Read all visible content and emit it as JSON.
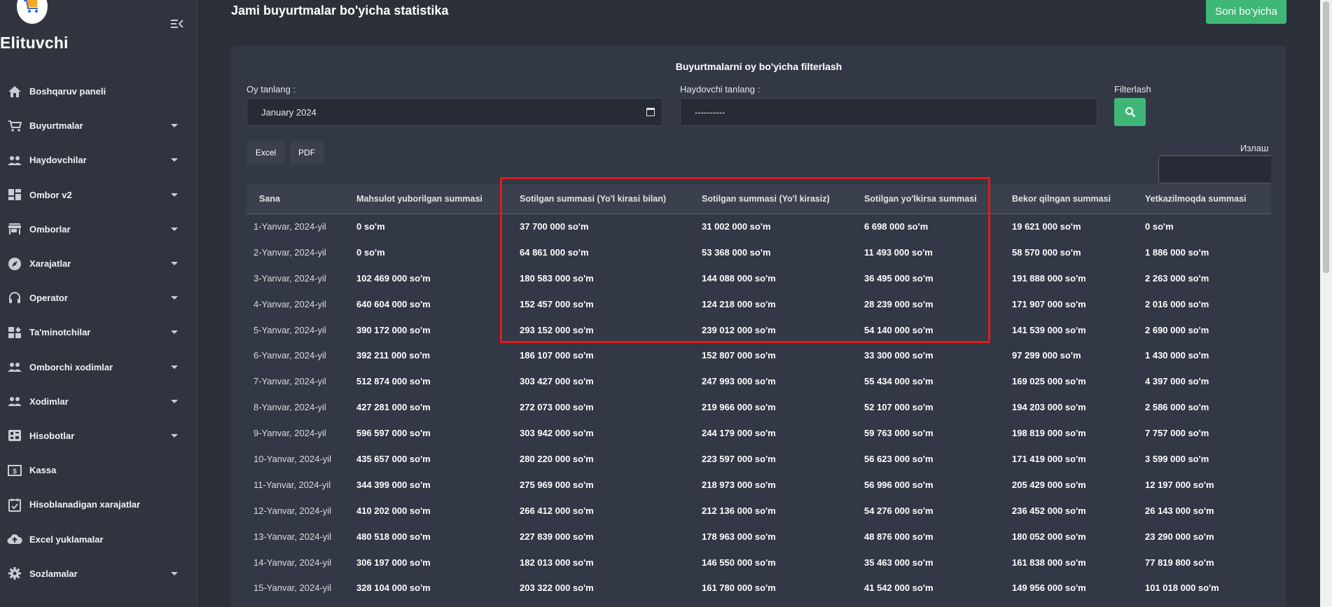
{
  "brand": "Elituvchi",
  "sidebar": {
    "items": [
      {
        "label": "Boshqaruv paneli",
        "icon": "home-icon",
        "has_submenu": false
      },
      {
        "label": "Buyurtmalar",
        "icon": "cart-icon",
        "has_submenu": true
      },
      {
        "label": "Haydovchilar",
        "icon": "people-icon",
        "has_submenu": true
      },
      {
        "label": "Ombor v2",
        "icon": "dashboard-icon",
        "has_submenu": true
      },
      {
        "label": "Omborlar",
        "icon": "store-icon",
        "has_submenu": true
      },
      {
        "label": "Xarajatlar",
        "icon": "explore-icon",
        "has_submenu": true
      },
      {
        "label": "Operator",
        "icon": "headset-icon",
        "has_submenu": true
      },
      {
        "label": "Ta'minotchilar",
        "icon": "suppliers-icon",
        "has_submenu": true
      },
      {
        "label": "Omborchi xodimlar",
        "icon": "people-icon",
        "has_submenu": true
      },
      {
        "label": "Xodimlar",
        "icon": "people-icon",
        "has_submenu": true
      },
      {
        "label": "Hisobotlar",
        "icon": "grid-icon",
        "has_submenu": true
      },
      {
        "label": "Kassa",
        "icon": "money-icon",
        "has_submenu": false
      },
      {
        "label": "Hisoblanadigan xarajatlar",
        "icon": "calendar-check-icon",
        "has_submenu": false
      },
      {
        "label": "Excel yuklamalar",
        "icon": "cloud-upload-icon",
        "has_submenu": false
      },
      {
        "label": "Sozlamalar",
        "icon": "gear-icon",
        "has_submenu": true
      }
    ]
  },
  "header": {
    "title": "Jami buyurtmalar bo'yicha statistika",
    "soni_button": "Soni bo'yicha"
  },
  "filter": {
    "title": "Buyurtmalarni oy bo'yicha filterlash",
    "month_label": "Oy tanlang :",
    "month_value": "January 2024",
    "driver_label": "Haydovchi tanlang :",
    "driver_value": "----------",
    "filter_label": "Filterlash"
  },
  "export": {
    "excel": "Excel",
    "pdf": "PDF"
  },
  "search": {
    "label": "Излаш"
  },
  "colors": {
    "accent_green": "#3fb877",
    "highlight_red": "#e01b1b"
  },
  "table": {
    "headers": [
      "Sana",
      "Mahsulot yuborilgan summasi",
      "Sotilgan summasi (Yo'l kirasi bilan)",
      "Sotilgan summasi (Yo'l kirasiz)",
      "Sotilgan yo'lkirsa summasi",
      "Bekor qilngan summasi",
      "Yetkazilmoqda summasi"
    ],
    "rows": [
      [
        "1-Yanvar, 2024-yil",
        "0 so'm",
        "37 700 000 so'm",
        "31 002 000 so'm",
        "6 698 000 so'm",
        "19 621 000 so'm",
        "0 so'm"
      ],
      [
        "2-Yanvar, 2024-yil",
        "0 so'm",
        "64 861 000 so'm",
        "53 368 000 so'm",
        "11 493 000 so'm",
        "58 570 000 so'm",
        "1 886 000 so'm"
      ],
      [
        "3-Yanvar, 2024-yil",
        "102 469 000 so'm",
        "180 583 000 so'm",
        "144 088 000 so'm",
        "36 495 000 so'm",
        "191 888 000 so'm",
        "2 263 000 so'm"
      ],
      [
        "4-Yanvar, 2024-yil",
        "640 604 000 so'm",
        "152 457 000 so'm",
        "124 218 000 so'm",
        "28 239 000 so'm",
        "171 907 000 so'm",
        "2 016 000 so'm"
      ],
      [
        "5-Yanvar, 2024-yil",
        "390 172 000 so'm",
        "293 152 000 so'm",
        "239 012 000 so'm",
        "54 140 000 so'm",
        "141 539 000 so'm",
        "2 690 000 so'm"
      ],
      [
        "6-Yanvar, 2024-yil",
        "392 211 000 so'm",
        "186 107 000 so'm",
        "152 807 000 so'm",
        "33 300 000 so'm",
        "97 299 000 so'm",
        "1 430 000 so'm"
      ],
      [
        "7-Yanvar, 2024-yil",
        "512 874 000 so'm",
        "303 427 000 so'm",
        "247 993 000 so'm",
        "55 434 000 so'm",
        "169 025 000 so'm",
        "4 397 000 so'm"
      ],
      [
        "8-Yanvar, 2024-yil",
        "427 281 000 so'm",
        "272 073 000 so'm",
        "219 966 000 so'm",
        "52 107 000 so'm",
        "194 203 000 so'm",
        "2 586 000 so'm"
      ],
      [
        "9-Yanvar, 2024-yil",
        "596 597 000 so'm",
        "303 942 000 so'm",
        "244 179 000 so'm",
        "59 763 000 so'm",
        "198 819 000 so'm",
        "7 757 000 so'm"
      ],
      [
        "10-Yanvar, 2024-yil",
        "435 657 000 so'm",
        "280 220 000 so'm",
        "223 597 000 so'm",
        "56 623 000 so'm",
        "171 419 000 so'm",
        "3 599 000 so'm"
      ],
      [
        "11-Yanvar, 2024-yil",
        "344 399 000 so'm",
        "275 969 000 so'm",
        "218 973 000 so'm",
        "56 996 000 so'm",
        "205 429 000 so'm",
        "12 197 000 so'm"
      ],
      [
        "12-Yanvar, 2024-yil",
        "410 202 000 so'm",
        "266 412 000 so'm",
        "212 136 000 so'm",
        "54 276 000 so'm",
        "236 452 000 so'm",
        "26 143 000 so'm"
      ],
      [
        "13-Yanvar, 2024-yil",
        "480 518 000 so'm",
        "227 839 000 so'm",
        "178 963 000 so'm",
        "48 876 000 so'm",
        "180 052 000 so'm",
        "23 290 000 so'm"
      ],
      [
        "14-Yanvar, 2024-yil",
        "306 197 000 so'm",
        "182 013 000 so'm",
        "146 550 000 so'm",
        "35 463 000 so'm",
        "161 838 000 so'm",
        "77 819 800 so'm"
      ],
      [
        "15-Yanvar, 2024-yil",
        "328 104 000 so'm",
        "203 322 000 so'm",
        "161 780 000 so'm",
        "41 542 000 so'm",
        "149 956 000 so'm",
        "101 018 000 so'm"
      ]
    ]
  }
}
